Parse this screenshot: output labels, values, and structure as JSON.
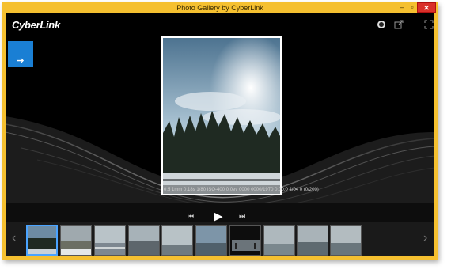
{
  "window": {
    "title": "Photo Gallery by CyberLink",
    "minimize": "–",
    "maximize": "▫",
    "close": "✕"
  },
  "logo": "CyberLink",
  "side_button": "➔",
  "caption": "0:5 1mm 0.18s 1/80 ISO-400 0.0ev 0000 0000/1970 0:00:0 4/04 0 (0/200)",
  "controls": {
    "prev": "⏮",
    "play": "▶",
    "next": "⏭"
  },
  "strip": {
    "prev": "‹",
    "next": "›",
    "thumbs": 10,
    "selected_index": 0
  }
}
